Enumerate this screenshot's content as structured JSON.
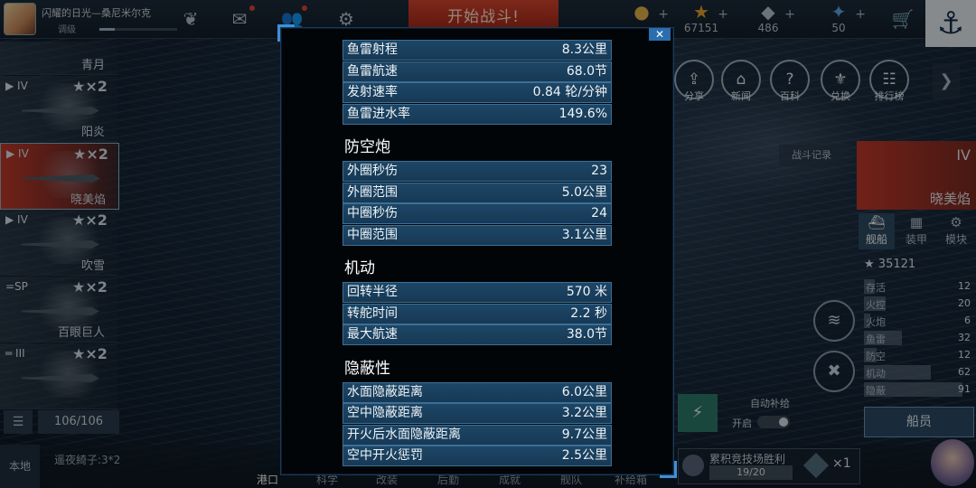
{
  "player": {
    "name": "闪耀的日光—桑尼米尔克",
    "rank": "调级"
  },
  "header": {
    "start_battle": "开始战斗!",
    "resources": [
      {
        "icon": "gold-coin-icon",
        "value": ""
      },
      {
        "icon": "star-icon",
        "value": "67151"
      },
      {
        "icon": "diamond-icon",
        "value": "486"
      },
      {
        "icon": "crystal-icon",
        "value": "50"
      }
    ]
  },
  "ships": [
    {
      "name": "青月",
      "tier": "",
      "count": ""
    },
    {
      "name": "阳炎",
      "tier": "IV",
      "count": "×2"
    },
    {
      "name": "晓美焰",
      "tier": "IV",
      "count": "×2"
    },
    {
      "name": "吹雪",
      "tier": "IV",
      "count": "×2"
    },
    {
      "name": "百眼巨人",
      "tier": "=SP",
      "count": "×2"
    },
    {
      "name": "",
      "tier": "III",
      "count": "×2"
    }
  ],
  "fleet_count": "106/106",
  "bottom": {
    "local": "本地",
    "chat": "遥夜綺子:3*2",
    "nav": [
      "港口",
      "科学",
      "改装",
      "后勤",
      "成就",
      "舰队",
      "补给箱"
    ]
  },
  "quick_menu": [
    "分享",
    "新闻",
    "百科",
    "兑换",
    "排行榜"
  ],
  "right": {
    "battle_record": "战斗记录",
    "ship_tier": "IV",
    "ship_name": "晓美焰",
    "tabs": [
      "舰船",
      "装甲",
      "模块"
    ],
    "power": "35121",
    "stats": [
      {
        "name": "存活",
        "value": "12",
        "fill": 0.1
      },
      {
        "name": "火控",
        "value": "20",
        "fill": 0.2
      },
      {
        "name": "火炮",
        "value": "6",
        "fill": 0.06
      },
      {
        "name": "鱼雷",
        "value": "32",
        "fill": 0.35
      },
      {
        "name": "防空",
        "value": "12",
        "fill": 0.12
      },
      {
        "name": "机动",
        "value": "62",
        "fill": 0.62
      },
      {
        "name": "隐蔽",
        "value": "91",
        "fill": 0.91
      }
    ],
    "crew_button": "船员",
    "auto_supply": {
      "label": "自动补给",
      "state": "开启"
    },
    "arena": {
      "label": "累积竞技场胜利",
      "progress": "19/20",
      "multiplier": "×1"
    }
  },
  "modal": {
    "close": "✕",
    "sections": [
      {
        "title": "",
        "rows": [
          {
            "k": "鱼雷射程",
            "v": "8.3公里"
          },
          {
            "k": "鱼雷航速",
            "v": "68.0节"
          },
          {
            "k": "发射速率",
            "v": "0.84 轮/分钟"
          },
          {
            "k": "鱼雷进水率",
            "v": "149.6%"
          }
        ]
      },
      {
        "title": "防空炮",
        "rows": [
          {
            "k": "外圈秒伤",
            "v": "23"
          },
          {
            "k": "外圈范围",
            "v": "5.0公里"
          },
          {
            "k": "中圈秒伤",
            "v": "24"
          },
          {
            "k": "中圈范围",
            "v": "3.1公里"
          }
        ]
      },
      {
        "title": "机动",
        "rows": [
          {
            "k": "回转半径",
            "v": "570 米"
          },
          {
            "k": "转舵时间",
            "v": "2.2 秒"
          },
          {
            "k": "最大航速",
            "v": "38.0节"
          }
        ]
      },
      {
        "title": "隐蔽性",
        "rows": [
          {
            "k": "水面隐蔽距离",
            "v": "6.0公里"
          },
          {
            "k": "空中隐蔽距离",
            "v": "3.2公里"
          },
          {
            "k": "开火后水面隐蔽距离",
            "v": "9.7公里"
          },
          {
            "k": "空中开火惩罚",
            "v": "2.5公里"
          }
        ]
      }
    ]
  }
}
